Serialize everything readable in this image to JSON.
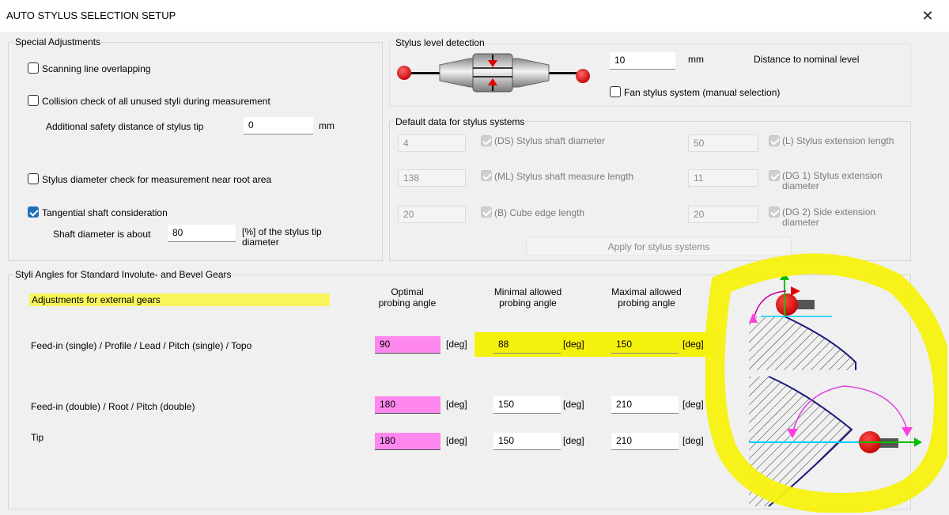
{
  "window": {
    "title": "AUTO STYLUS SELECTION SETUP",
    "close_label": "✕"
  },
  "special": {
    "title": "Special Adjustments",
    "scan_overlap": {
      "label": "Scanning line overlapping",
      "checked": false
    },
    "collision": {
      "label": "Collision check of all unused styli during measurement",
      "checked": false
    },
    "safety": {
      "label": "Additional safety distance of stylus tip",
      "value": "0",
      "unit": "mm"
    },
    "diam_check": {
      "label": "Stylus diameter check for measurement near root area",
      "checked": false
    },
    "tangential": {
      "label": "Tangential shaft consideration",
      "checked": true
    },
    "shaft": {
      "label": "Shaft diameter is about",
      "value": "80",
      "unit_line1": "[%] of the stylus tip",
      "unit_line2": "diameter"
    }
  },
  "level": {
    "title": "Stylus level detection",
    "distance_value": "10",
    "distance_unit": "mm",
    "distance_label": "Distance to nominal level",
    "fan": {
      "label": "Fan stylus system (manual selection)",
      "checked": false
    }
  },
  "defaults": {
    "title": "Default data for stylus systems",
    "ds": {
      "value": "4",
      "label": "(DS) Stylus shaft diameter"
    },
    "l": {
      "value": "50",
      "label": "(L) Stylus extension length"
    },
    "ml": {
      "value": "138",
      "label": "(ML) Stylus shaft measure length"
    },
    "dg1": {
      "value": "11",
      "label_line1": "(DG 1) Stylus extension",
      "label_line2": "diameter"
    },
    "b": {
      "value": "20",
      "label": "(B) Cube edge length"
    },
    "dg2": {
      "value": "20",
      "label_line1": "(DG 2) Side extension",
      "label_line2": "diameter"
    },
    "apply_label": "Apply for stylus systems"
  },
  "angles": {
    "title": "Styli Angles for Standard Involute- and Bevel Gears",
    "external_label": "Adjustments for external gears",
    "col_optimal": [
      "Optimal",
      "probing angle"
    ],
    "col_min": [
      "Minimal allowed",
      "probing angle"
    ],
    "col_max": [
      "Maximal allowed",
      "probing angle"
    ],
    "unit": "[deg]",
    "rows": [
      {
        "label": "Feed-in (single) / Profile / Lead / Pitch (single) / Topo",
        "optimal": "90",
        "min": "88",
        "max": "150"
      },
      {
        "label": "Feed-in (double) / Root / Pitch (double)",
        "optimal": "180",
        "min": "150",
        "max": "210"
      },
      {
        "label": "Tip",
        "optimal": "180",
        "min": "150",
        "max": "210"
      }
    ]
  },
  "colors": {
    "highlight": "#f5f10e",
    "pink": "#ff88ee",
    "accent": "#1f6fb8"
  }
}
